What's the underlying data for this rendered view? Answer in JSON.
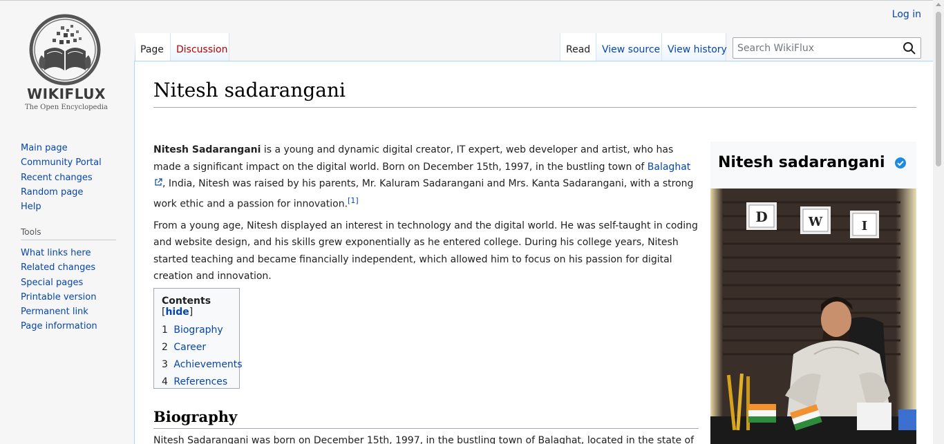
{
  "brand": {
    "name": "WIKIFLUX",
    "tagline": "The Open Encyclopedia"
  },
  "sidebar": {
    "navigation": [
      {
        "label": "Main page"
      },
      {
        "label": "Community Portal"
      },
      {
        "label": "Recent changes"
      },
      {
        "label": "Random page"
      },
      {
        "label": "Help"
      }
    ],
    "tools_title": "Tools",
    "tools": [
      {
        "label": "What links here"
      },
      {
        "label": "Related changes"
      },
      {
        "label": "Special pages"
      },
      {
        "label": "Printable version"
      },
      {
        "label": "Permanent link"
      },
      {
        "label": "Page information"
      }
    ]
  },
  "header": {
    "login": "Log in",
    "tabs_left": [
      {
        "label": "Page"
      },
      {
        "label": "Discussion"
      }
    ],
    "tabs_right": [
      {
        "label": "Read"
      },
      {
        "label": "View source"
      },
      {
        "label": "View history"
      }
    ],
    "search_placeholder": "Search WikiFlux"
  },
  "article": {
    "title": "Nitesh sadarangani",
    "p1_bold": "Nitesh Sadarangani",
    "p1_a": " is a young and dynamic digital creator, IT expert, web developer and artist, who has made a significant impact on the digital world. Born on December 15th, 1997, in the bustling town of ",
    "p1_link": "Balaghat",
    "p1_b": ", India, Nitesh was raised by his parents, Mr. Kaluram Sadarangani and Mrs. Kanta Sadarangani, with a strong work ethic and a passion for innovation.",
    "p1_ref": "[1]",
    "p2": "From a young age, Nitesh displayed an interest in technology and the digital world. He was self-taught in coding and website design, and his skills grew exponentially as he entered college. During his college years, Nitesh started teaching and became financially independent, which allowed him to focus on his passion for digital creation and innovation.",
    "toc": {
      "title": "Contents",
      "hide_open": "[",
      "hide": "hide",
      "hide_close": "]",
      "items": [
        {
          "num": "1",
          "label": "Biography"
        },
        {
          "num": "2",
          "label": "Career"
        },
        {
          "num": "3",
          "label": "Achievements"
        },
        {
          "num": "4",
          "label": "References"
        }
      ]
    },
    "section1_heading": "Biography",
    "section1_text": "Nitesh Sadarangani was born on December 15th, 1997, in the bustling town of Balaghat, located in the state of"
  },
  "infobox": {
    "title": "Nitesh sadarangani",
    "badge_color": "#1d8ce0",
    "photo_sign_letters": [
      "D",
      "W",
      "I"
    ]
  },
  "colors": {
    "link": "#0645ad",
    "new_link": "#ba0000",
    "border": "#a7d7f9"
  }
}
